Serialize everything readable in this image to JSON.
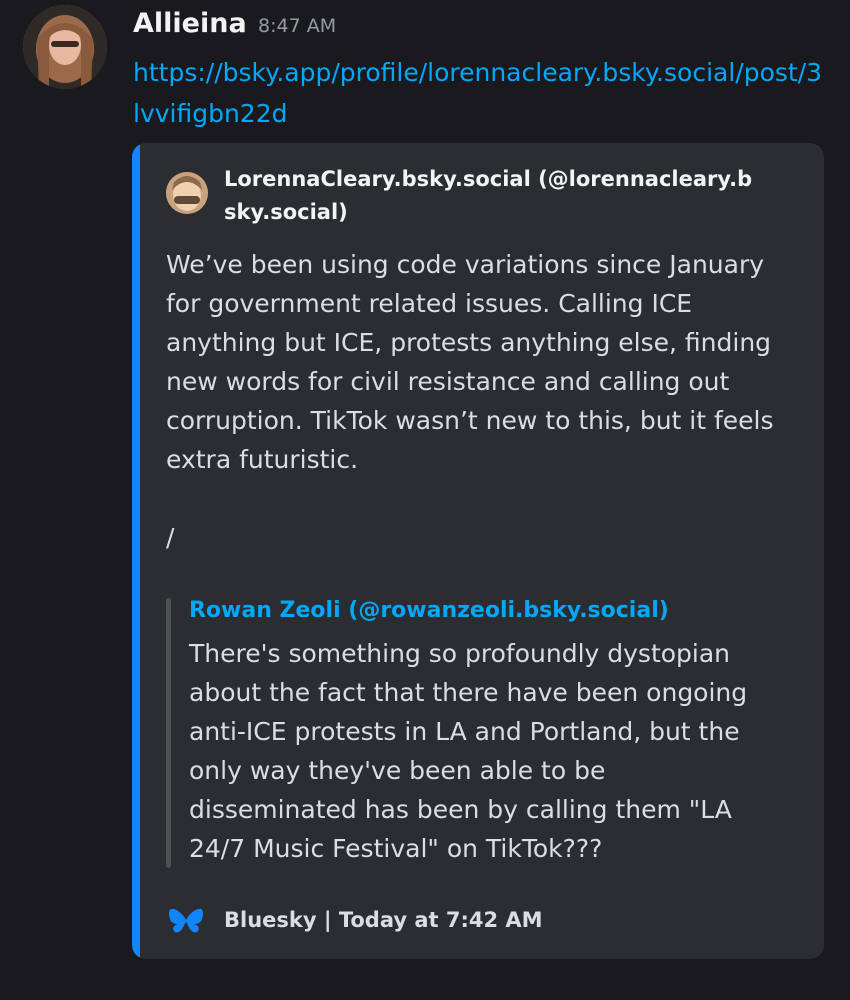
{
  "message": {
    "author": "Allieina",
    "timestamp": "8:47 AM",
    "link": "https://bsky.app/profile/lorennacleary.bsky.social/post/3lvvifigbn22d"
  },
  "embed": {
    "author": "LorennaCleary.bsky.social (@lorennacleary.bsky.social)",
    "text": "We’ve been using code variations since January for government related issues. Calling ICE anything but ICE, protests anything else, finding new words for civil resistance and calling out corruption. TikTok wasn’t new to this, but it feels extra futuristic.\n\n/",
    "quote": {
      "author": "Rowan Zeoli (@rowanzeoli.bsky.social)",
      "text": "There's something so profoundly dystopian about the fact that there have been ongoing anti-ICE protests in LA and Portland, but the only way they've been able to be disseminated has been by calling them \"LA 24/7 Music Festival\" on TikTok???"
    },
    "footer": {
      "icon": "butterfly-icon",
      "text": "Bluesky | Today at 7:42 AM"
    }
  },
  "colors": {
    "background": "#1a1a1e",
    "embed_background": "#2b2d31",
    "embed_accent": "#1185fe",
    "link": "#00a8fc"
  }
}
